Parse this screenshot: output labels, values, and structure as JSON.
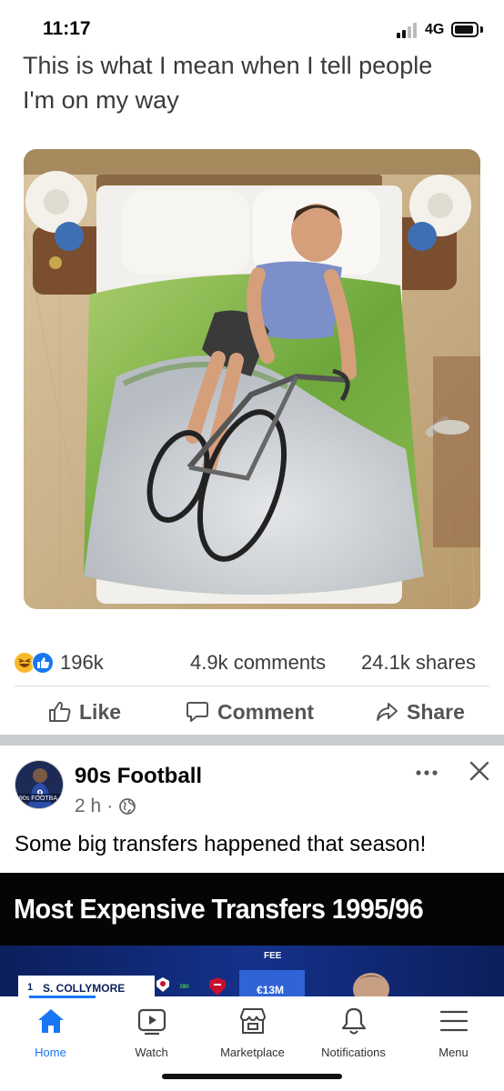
{
  "status_bar": {
    "time": "11:17",
    "network": "4G",
    "signal_bars_active": 2,
    "signal_bars_total": 4
  },
  "post": {
    "caption_lines": [
      "This is what I mean when I tell people",
      "I'm on my way"
    ],
    "image_icon": "meme-photo-bicycle-duvet",
    "reaction_count": "196k",
    "comments": "4.9k comments",
    "shares": "24.1k shares",
    "actions": {
      "like": "Like",
      "comment": "Comment",
      "share": "Share"
    }
  },
  "next_post": {
    "page_name": "90s Football",
    "avatar_text": "90s FOOTBA",
    "time": "2 h",
    "separator": "·",
    "text": "Some big transfers happened that season!",
    "graphic": {
      "title": "Most Expensive Transfers 1995/96",
      "fee_header": "FEE",
      "rows": [
        {
          "rank": "1",
          "player": "S. COLLYMORE",
          "arrows": "»»",
          "fee": "€13M"
        }
      ]
    }
  },
  "nav": {
    "items": [
      {
        "label": "Home",
        "icon": "home-icon"
      },
      {
        "label": "Watch",
        "icon": "watch-icon"
      },
      {
        "label": "Marketplace",
        "icon": "marketplace-icon"
      },
      {
        "label": "Notifications",
        "icon": "bell-icon"
      },
      {
        "label": "Menu",
        "icon": "hamburger-icon"
      }
    ]
  },
  "colors": {
    "accent": "#1877f2",
    "text": "#050505",
    "muted": "#65676b",
    "separator": "#c9ccd1"
  }
}
